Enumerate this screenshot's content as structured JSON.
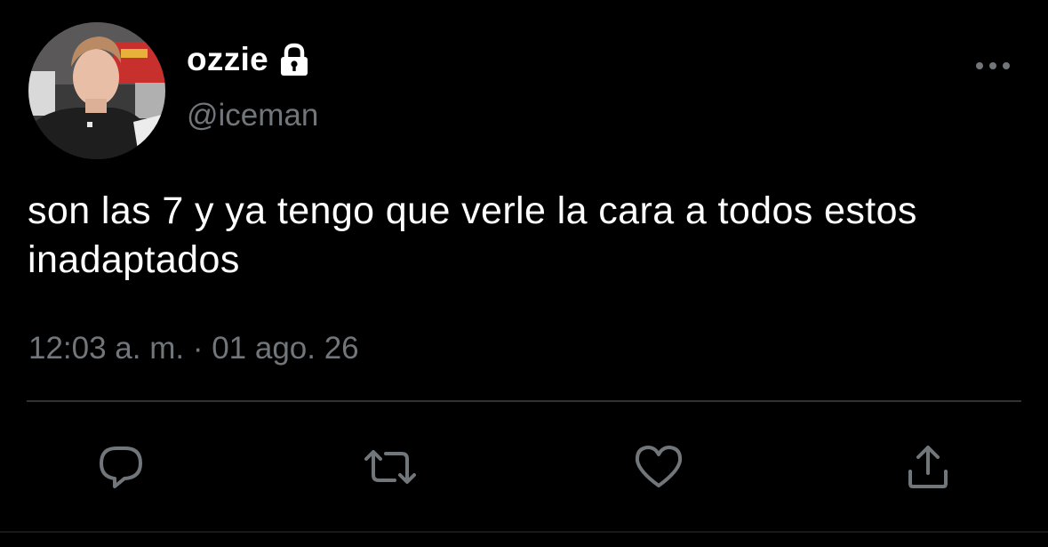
{
  "theme": {
    "background": "#000000",
    "text_primary": "#ffffff",
    "text_secondary": "#71767b",
    "divider": "#2f3336",
    "icon_color": "#71767b"
  },
  "author": {
    "display_name": "ozzie",
    "handle": "@iceman",
    "protected": true,
    "verified_icon": "lock-icon",
    "avatar": "profile-photo"
  },
  "tweet": {
    "text": "son las 7 y ya tengo que verle la cara a todos estos inadaptados",
    "timestamp": "12:03 a. m. · 01 ago. 26"
  },
  "header": {
    "more_icon": "more-horizontal-icon"
  },
  "actions": [
    {
      "name": "reply",
      "icon": "comment-icon"
    },
    {
      "name": "retweet",
      "icon": "retweet-icon"
    },
    {
      "name": "like",
      "icon": "heart-icon"
    },
    {
      "name": "share",
      "icon": "share-icon"
    }
  ]
}
